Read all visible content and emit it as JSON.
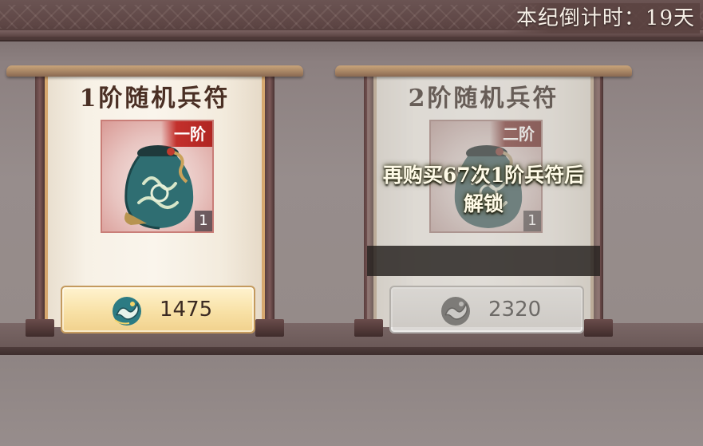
{
  "header": {
    "countdown_text": "本纪倒计时：19天"
  },
  "cards": [
    {
      "title": "1阶随机兵符",
      "tier_badge": "一阶",
      "quantity": "1",
      "price": "1475",
      "locked": false,
      "icon": "jade-pouch-icon",
      "currency_icon": "dragon-coin-icon"
    },
    {
      "title": "2阶随机兵符",
      "tier_badge": "二阶",
      "quantity": "1",
      "price": "2320",
      "locked": true,
      "lock_message": "再购买67次1阶兵符后解锁",
      "icon": "jade-pouch-icon",
      "currency_icon": "dragon-coin-icon"
    }
  ],
  "colors": {
    "tier_badge_red": "#c3302c",
    "price_button_gold": "#f8e1a6",
    "locked_button_gray": "#dcd7d0"
  }
}
